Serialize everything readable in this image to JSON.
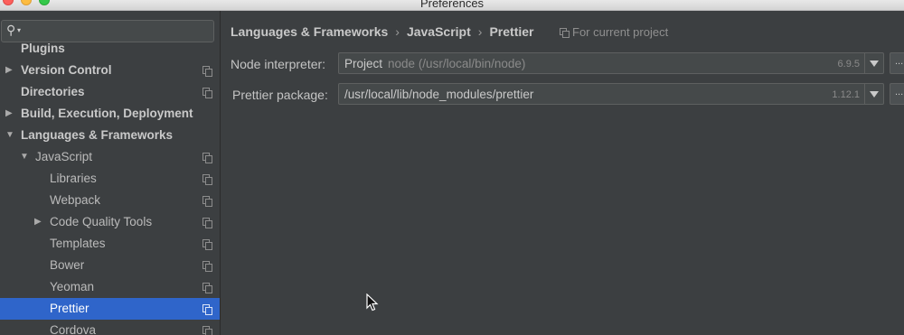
{
  "window": {
    "title": "Preferences"
  },
  "search": {
    "value": "",
    "icon": "search-icon"
  },
  "sidebar": {
    "items": [
      {
        "label": "Plugins",
        "level": 0,
        "bold": true,
        "arrow": "",
        "copy": false
      },
      {
        "label": "Version Control",
        "level": 0,
        "bold": true,
        "arrow": "▶",
        "copy": true
      },
      {
        "label": "Directories",
        "level": 0,
        "bold": true,
        "arrow": "",
        "copy": true
      },
      {
        "label": "Build, Execution, Deployment",
        "level": 0,
        "bold": true,
        "arrow": "▶",
        "copy": false
      },
      {
        "label": "Languages & Frameworks",
        "level": 0,
        "bold": true,
        "arrow": "▼",
        "copy": false
      },
      {
        "label": "JavaScript",
        "level": 1,
        "bold": false,
        "arrow": "▼",
        "copy": true
      },
      {
        "label": "Libraries",
        "level": 2,
        "bold": false,
        "arrow": "",
        "copy": true
      },
      {
        "label": "Webpack",
        "level": 2,
        "bold": false,
        "arrow": "",
        "copy": true
      },
      {
        "label": "Code Quality Tools",
        "level": 2,
        "bold": false,
        "arrow": "▶",
        "copy": true
      },
      {
        "label": "Templates",
        "level": 2,
        "bold": false,
        "arrow": "",
        "copy": true
      },
      {
        "label": "Bower",
        "level": 2,
        "bold": false,
        "arrow": "",
        "copy": true
      },
      {
        "label": "Yeoman",
        "level": 2,
        "bold": false,
        "arrow": "",
        "copy": true
      },
      {
        "label": "Prettier",
        "level": 2,
        "bold": false,
        "arrow": "",
        "copy": true,
        "selected": true
      },
      {
        "label": "Cordova",
        "level": 2,
        "bold": false,
        "arrow": "",
        "copy": true
      }
    ]
  },
  "breadcrumb": {
    "items": [
      "Languages & Frameworks",
      "JavaScript",
      "Prettier"
    ],
    "separator": "›",
    "scope_label": "For current project"
  },
  "form": {
    "node_interpreter": {
      "label": "Node interpreter:",
      "value": "Project",
      "detail": "node (/usr/local/bin/node)",
      "version": "6.9.5",
      "browse": "..."
    },
    "prettier_package": {
      "label": "Prettier package:",
      "value": "/usr/local/lib/node_modules/prettier",
      "version": "1.12.1",
      "browse": "..."
    }
  },
  "colors": {
    "background": "#3c3f41",
    "selection": "#2f65ca",
    "text": "#bbbbbb"
  }
}
